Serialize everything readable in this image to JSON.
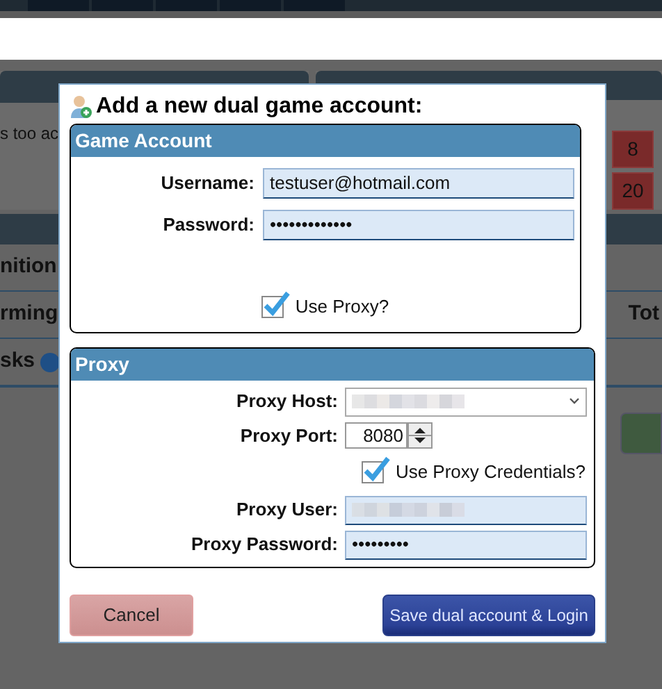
{
  "background": {
    "left_panel_text": "s too ac",
    "cells": [
      {
        "text": "8"
      },
      {
        "text": "20"
      }
    ],
    "rows": [
      {
        "label": "nition"
      },
      {
        "label": "rming",
        "column": "Tot"
      },
      {
        "label": "sks",
        "help": true
      }
    ]
  },
  "dialog": {
    "title": "Add a new dual game account:",
    "game_account": {
      "title": "Game Account",
      "username": {
        "label": "Username:",
        "value": "testuser@hotmail.com"
      },
      "password": {
        "label": "Password:",
        "value": "•••••••••••••"
      },
      "use_proxy": {
        "label": "Use Proxy?",
        "checked": true
      }
    },
    "proxy": {
      "title": "Proxy",
      "host": {
        "label": "Proxy Host:"
      },
      "port": {
        "label": "Proxy Port:",
        "value": "8080"
      },
      "use_credentials": {
        "label": "Use Proxy Credentials?",
        "checked": true
      },
      "user": {
        "label": "Proxy User:"
      },
      "password": {
        "label": "Proxy Password:",
        "value": "•••••••••"
      }
    },
    "buttons": [
      {
        "label": "Cancel",
        "kind": "cancel"
      },
      {
        "label": "Save dual account & Login",
        "kind": "primary"
      }
    ]
  }
}
